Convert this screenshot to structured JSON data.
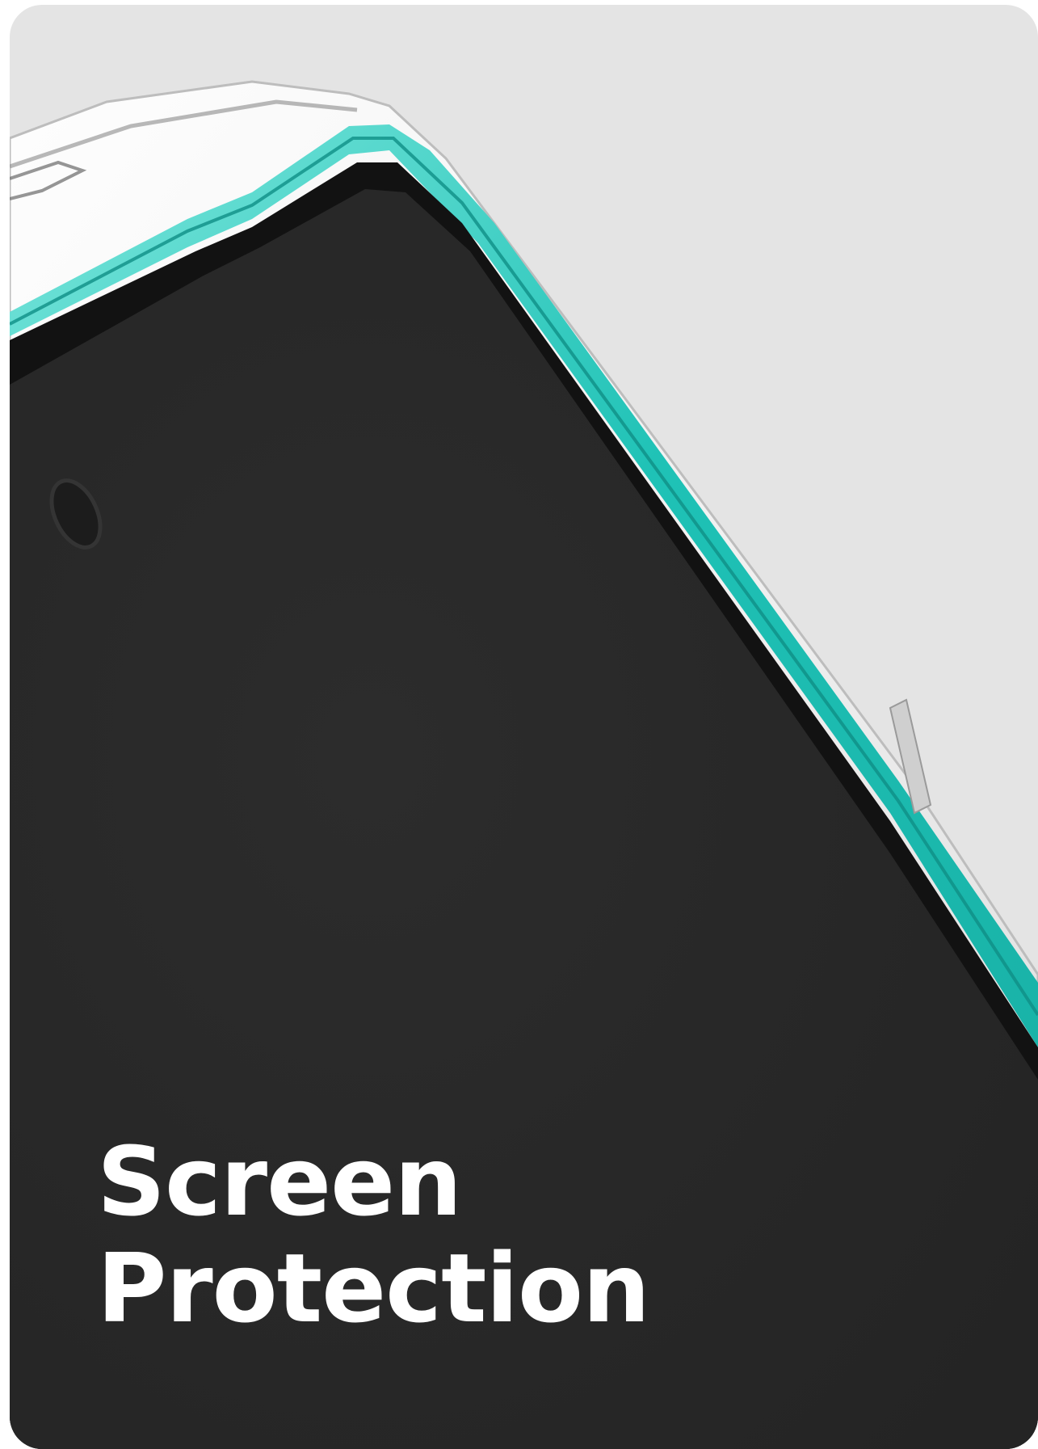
{
  "caption": {
    "line1": "Screen",
    "line2": "Protection"
  },
  "colors": {
    "background": "#e4e4e4",
    "screen": "#282828",
    "accent_edge": "#1fc2b6",
    "text": "#ffffff"
  }
}
